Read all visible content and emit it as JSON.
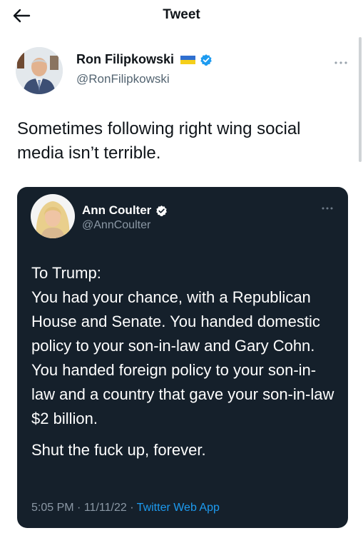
{
  "header": {
    "title": "Tweet"
  },
  "tweet": {
    "author": {
      "name": "Ron Filipkowski",
      "handle": "@RonFilipkowski"
    },
    "text": "Sometimes following right wing social media isn’t terrible."
  },
  "quoted_tweet": {
    "author": {
      "name": "Ann Coulter",
      "handle": "@AnnCoulter"
    },
    "body_paragraph_1": "To Trump:\nYou had your chance, with a Republican House and Senate. You handed domestic policy to your son-in-law and Gary Cohn. You handed foreign policy to your son-in-law and a country that gave your son-in-law $2 billion.",
    "body_paragraph_2": "Shut the fuck up, forever.",
    "time": "5:05 PM",
    "separator": "·",
    "date": "11/11/22",
    "source_app": "Twitter Web App"
  },
  "icons": {
    "back": "arrow-left",
    "verified": "verified-badge",
    "flag": "ukraine-flag",
    "more": "more-horizontal"
  },
  "colors": {
    "accent": "#1d9bf0",
    "quote_background": "#15202b",
    "secondary_text": "#536471",
    "flag_blue": "#2f6fd0",
    "flag_yellow": "#f5cf1a"
  }
}
